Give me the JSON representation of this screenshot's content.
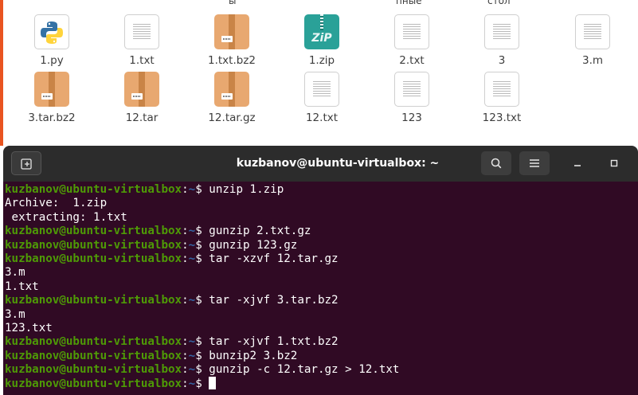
{
  "file_manager": {
    "clipped_labels": [
      "ы",
      "пные",
      "стол"
    ],
    "files": [
      {
        "name": "1.py",
        "icon": "python-file-icon"
      },
      {
        "name": "1.txt",
        "icon": "text-file-icon"
      },
      {
        "name": "1.txt.bz2",
        "icon": "archive-file-icon"
      },
      {
        "name": "1.zip",
        "icon": "zip-file-icon"
      },
      {
        "name": "2.txt",
        "icon": "text-file-icon"
      },
      {
        "name": "3",
        "icon": "text-file-icon"
      },
      {
        "name": "3.m",
        "icon": "text-file-icon"
      },
      {
        "name": "3.tar.bz2",
        "icon": "archive-file-icon"
      },
      {
        "name": "12.tar",
        "icon": "archive-file-icon"
      },
      {
        "name": "12.tar.gz",
        "icon": "archive-file-icon"
      },
      {
        "name": "12.txt",
        "icon": "text-file-icon"
      },
      {
        "name": "123",
        "icon": "text-file-icon"
      },
      {
        "name": "123.txt",
        "icon": "text-file-icon"
      }
    ]
  },
  "terminal": {
    "title": "kuzbanov@ubuntu-virtualbox: ~",
    "buttons": {
      "new_tab": "new-tab-icon",
      "search": "search-icon",
      "menu": "hamburger-menu-icon",
      "minimize": "minimize-icon",
      "maximize": "maximize-icon"
    },
    "prompt_user": "kuzbanov@ubuntu-virtualbox",
    "prompt_path": "~",
    "lines": [
      {
        "type": "cmd",
        "text": "unzip 1.zip"
      },
      {
        "type": "out",
        "text": "Archive:  1.zip"
      },
      {
        "type": "out",
        "text": " extracting: 1.txt"
      },
      {
        "type": "cmd",
        "text": "gunzip 2.txt.gz"
      },
      {
        "type": "cmd",
        "text": "gunzip 123.gz"
      },
      {
        "type": "cmd",
        "text": "tar -xzvf 12.tar.gz"
      },
      {
        "type": "out",
        "text": "3.m"
      },
      {
        "type": "out",
        "text": "1.txt"
      },
      {
        "type": "cmd",
        "text": "tar -xjvf 3.tar.bz2"
      },
      {
        "type": "out",
        "text": "3.m"
      },
      {
        "type": "out",
        "text": "123.txt"
      },
      {
        "type": "cmd",
        "text": "tar -xjvf 1.txt.bz2"
      },
      {
        "type": "cmd",
        "text": "bunzip2 3.bz2"
      },
      {
        "type": "cmd",
        "text": "gunzip -c 12.tar.gz > 12.txt"
      },
      {
        "type": "cursor",
        "text": ""
      }
    ]
  }
}
